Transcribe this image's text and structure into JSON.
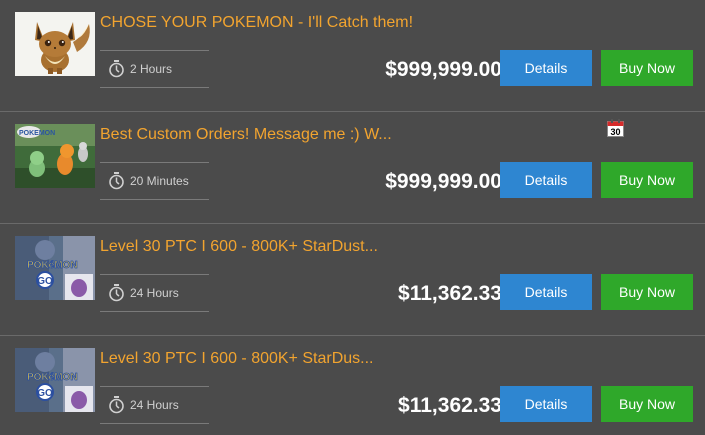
{
  "listings": [
    {
      "thumb_icon": "eevee-thumbnail",
      "title": "CHOSE YOUR POKEMON - I'll Catch them!",
      "duration": "2 Hours",
      "price": "$999,999.00",
      "details_label": "Details",
      "buy_label": "Buy Now",
      "calendar": false
    },
    {
      "thumb_icon": "pokemon-go-scene-thumbnail",
      "title": "Best Custom Orders! Message me :) W...",
      "duration": "20 Minutes",
      "price": "$999,999.00",
      "details_label": "Details",
      "buy_label": "Buy Now",
      "calendar": true,
      "calendar_day": "30"
    },
    {
      "thumb_icon": "pokemon-go-logo-thumbnail",
      "title": "Level 30 PTC I 600 - 800K+ StarDust...",
      "duration": "24 Hours",
      "price": "$11,362.33",
      "details_label": "Details",
      "buy_label": "Buy Now",
      "calendar": false
    },
    {
      "thumb_icon": "pokemon-go-logo-thumbnail",
      "title": "Level 30 PTC I 600 - 800K+ StarDus...",
      "duration": "24 Hours",
      "price": "$11,362.33",
      "details_label": "Details",
      "buy_label": "Buy Now",
      "calendar": false
    }
  ],
  "colors": {
    "background": "#4a4a4a",
    "title": "#f2a42f",
    "details_button": "#2e86d1",
    "buy_button": "#2fa82a"
  }
}
